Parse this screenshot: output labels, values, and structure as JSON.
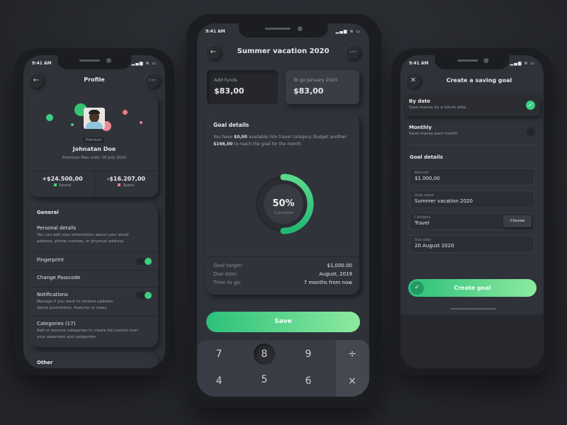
{
  "status": {
    "time": "9:41 AM",
    "signal": "▂▄▆ ≋ ▭"
  },
  "profile": {
    "title": "Profile",
    "badge": "Premium",
    "name": "Johnatan Doe",
    "plan": "Premium Plan until: 05 July 2020",
    "saved_value": "+$24.500,00",
    "saved_label": "Saved",
    "spent_value": "-$16.207,00",
    "spent_label": "Spent",
    "general": "General",
    "items": [
      {
        "title": "Personal details",
        "desc": "You can edit your information about your email address, phone number, or physical address."
      },
      {
        "title": "Fingerprint",
        "toggle": true
      },
      {
        "title": "Change Passcode"
      },
      {
        "title": "Notifications",
        "desc": "Manage if you want to receive updates about promotions, features or news",
        "toggle": true
      },
      {
        "title": "Categories (17)",
        "desc": "Add or remove categories to create full control over your expenses and categories"
      }
    ],
    "other": "Other"
  },
  "goal": {
    "title": "Summer vacation 2020",
    "add_funds_label": "Add funds",
    "add_funds_value": "$83,00",
    "togo_label": "To go January 2020",
    "togo_value": "$83,00",
    "details_title": "Goal details",
    "details_text_1": "You have ",
    "details_amount_1": "$0,00",
    "details_text_2": " available into travel category. Budget another ",
    "details_amount_2": "$166,00",
    "details_text_3": " to reach the goal for the month.",
    "progress_percent": 50,
    "progress_label": "50%",
    "progress_caption": "Complete",
    "rows": [
      {
        "label": "Goal target:",
        "value": "$1,000.00"
      },
      {
        "label": "Due date:",
        "value": "August, 2019"
      },
      {
        "label": "Time to go:",
        "value": "7 months from now"
      }
    ],
    "save": "Save",
    "keys": [
      "7",
      "8",
      "9",
      "÷",
      "4",
      "5",
      "6",
      "×"
    ]
  },
  "create": {
    "title": "Create a saving goal",
    "options": [
      {
        "title": "By date",
        "desc": "Save money by a future date.",
        "selected": true
      },
      {
        "title": "Monthly",
        "desc": "Save money each month",
        "selected": false
      }
    ],
    "details_title": "Goal details",
    "fields": [
      {
        "label": "Amount",
        "value": "$1.000,00"
      },
      {
        "label": "Goal name",
        "value": "Summer vacation 2020"
      },
      {
        "label": "Category",
        "value": "Travel",
        "button": "Choose"
      },
      {
        "label": "Due date",
        "value": "20 August 2020"
      }
    ],
    "submit": "Create goal"
  },
  "colors": {
    "accent": "#3ccf7f",
    "spent": "#e97b8a",
    "background": "#2f3239"
  }
}
